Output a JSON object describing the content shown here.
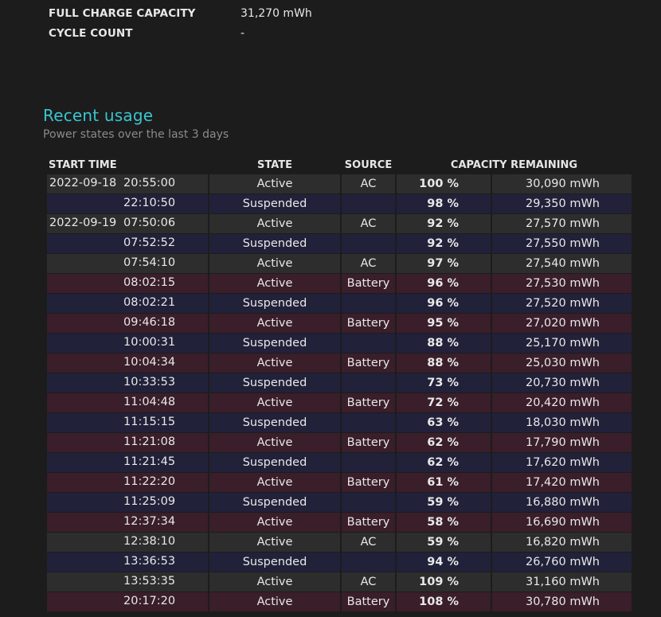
{
  "info": {
    "rows": [
      {
        "label": "FULL CHARGE CAPACITY",
        "value": "31,270 mWh"
      },
      {
        "label": "CYCLE COUNT",
        "value": "-"
      }
    ]
  },
  "recent_usage": {
    "title": "Recent usage",
    "subtitle": "Power states over the last 3 days",
    "headers": {
      "start_time": "START TIME",
      "state": "STATE",
      "source": "SOURCE",
      "capacity_remaining": "CAPACITY REMAINING"
    },
    "rows": [
      {
        "date": "2022-09-18",
        "time": "20:55:00",
        "state": "Active",
        "source": "AC",
        "percent": "100 %",
        "capacity": "30,090 mWh",
        "kind": "ac"
      },
      {
        "date": "",
        "time": "22:10:50",
        "state": "Suspended",
        "source": "",
        "percent": "98 %",
        "capacity": "29,350 mWh",
        "kind": "susp"
      },
      {
        "date": "2022-09-19",
        "time": "07:50:06",
        "state": "Active",
        "source": "AC",
        "percent": "92 %",
        "capacity": "27,570 mWh",
        "kind": "ac"
      },
      {
        "date": "",
        "time": "07:52:52",
        "state": "Suspended",
        "source": "",
        "percent": "92 %",
        "capacity": "27,550 mWh",
        "kind": "susp"
      },
      {
        "date": "",
        "time": "07:54:10",
        "state": "Active",
        "source": "AC",
        "percent": "97 %",
        "capacity": "27,540 mWh",
        "kind": "ac"
      },
      {
        "date": "",
        "time": "08:02:15",
        "state": "Active",
        "source": "Battery",
        "percent": "96 %",
        "capacity": "27,530 mWh",
        "kind": "batt"
      },
      {
        "date": "",
        "time": "08:02:21",
        "state": "Suspended",
        "source": "",
        "percent": "96 %",
        "capacity": "27,520 mWh",
        "kind": "susp"
      },
      {
        "date": "",
        "time": "09:46:18",
        "state": "Active",
        "source": "Battery",
        "percent": "95 %",
        "capacity": "27,020 mWh",
        "kind": "batt"
      },
      {
        "date": "",
        "time": "10:00:31",
        "state": "Suspended",
        "source": "",
        "percent": "88 %",
        "capacity": "25,170 mWh",
        "kind": "susp"
      },
      {
        "date": "",
        "time": "10:04:34",
        "state": "Active",
        "source": "Battery",
        "percent": "88 %",
        "capacity": "25,030 mWh",
        "kind": "batt"
      },
      {
        "date": "",
        "time": "10:33:53",
        "state": "Suspended",
        "source": "",
        "percent": "73 %",
        "capacity": "20,730 mWh",
        "kind": "susp"
      },
      {
        "date": "",
        "time": "11:04:48",
        "state": "Active",
        "source": "Battery",
        "percent": "72 %",
        "capacity": "20,420 mWh",
        "kind": "batt"
      },
      {
        "date": "",
        "time": "11:15:15",
        "state": "Suspended",
        "source": "",
        "percent": "63 %",
        "capacity": "18,030 mWh",
        "kind": "susp"
      },
      {
        "date": "",
        "time": "11:21:08",
        "state": "Active",
        "source": "Battery",
        "percent": "62 %",
        "capacity": "17,790 mWh",
        "kind": "batt"
      },
      {
        "date": "",
        "time": "11:21:45",
        "state": "Suspended",
        "source": "",
        "percent": "62 %",
        "capacity": "17,620 mWh",
        "kind": "susp"
      },
      {
        "date": "",
        "time": "11:22:20",
        "state": "Active",
        "source": "Battery",
        "percent": "61 %",
        "capacity": "17,420 mWh",
        "kind": "batt"
      },
      {
        "date": "",
        "time": "11:25:09",
        "state": "Suspended",
        "source": "",
        "percent": "59 %",
        "capacity": "16,880 mWh",
        "kind": "susp"
      },
      {
        "date": "",
        "time": "12:37:34",
        "state": "Active",
        "source": "Battery",
        "percent": "58 %",
        "capacity": "16,690 mWh",
        "kind": "batt"
      },
      {
        "date": "",
        "time": "12:38:10",
        "state": "Active",
        "source": "AC",
        "percent": "59 %",
        "capacity": "16,820 mWh",
        "kind": "ac"
      },
      {
        "date": "",
        "time": "13:36:53",
        "state": "Suspended",
        "source": "",
        "percent": "94 %",
        "capacity": "26,760 mWh",
        "kind": "susp"
      },
      {
        "date": "",
        "time": "13:53:35",
        "state": "Active",
        "source": "AC",
        "percent": "109 %",
        "capacity": "31,160 mWh",
        "kind": "ac"
      },
      {
        "date": "",
        "time": "20:17:20",
        "state": "Active",
        "source": "Battery",
        "percent": "108 %",
        "capacity": "30,780 mWh",
        "kind": "batt"
      }
    ]
  },
  "colors": {
    "background": "#1c1c1c",
    "accent_title": "#39c5cf",
    "row_ac": "#2d2d2d",
    "row_suspended": "#21213a",
    "row_battery": "#3a1e2a"
  }
}
